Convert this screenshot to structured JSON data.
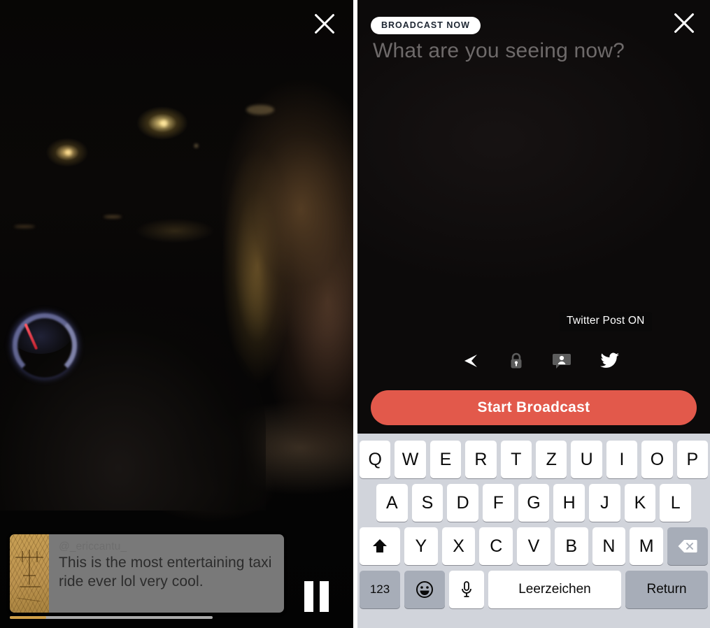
{
  "left_panel": {
    "name": "live-video-player",
    "close_icon": "close-x-icon",
    "scene_description": "night time taxi ride dashcam view",
    "playback": {
      "state_icon": "pause-icon",
      "progress_percent": 18
    },
    "comment": {
      "handle": "@_ericcantu_",
      "text": "This is the most entertaining taxi ride ever lol very cool.",
      "avatar_icon": "sketch-face-avatar"
    }
  },
  "right_panel": {
    "badge": "BROADCAST NOW",
    "close_icon": "close-x-icon",
    "compose": {
      "placeholder": "What are you seeing now?",
      "value": ""
    },
    "tooltip": "Twitter Post ON",
    "options": [
      {
        "name": "location-icon",
        "label": "Location",
        "state": "on",
        "color": "#ffffff"
      },
      {
        "name": "lock-icon",
        "label": "Private",
        "state": "off",
        "color": "#5c5c5c"
      },
      {
        "name": "chat-person-icon",
        "label": "Chat",
        "state": "off",
        "color": "#5c5c5c"
      },
      {
        "name": "twitter-bird-icon",
        "label": "Twitter Post",
        "state": "on",
        "color": "#ffffff"
      }
    ],
    "start_button": {
      "label": "Start Broadcast",
      "color": "#e2594b"
    }
  },
  "keyboard": {
    "layout": "QWERTZ",
    "row1": [
      "Q",
      "W",
      "E",
      "R",
      "T",
      "Z",
      "U",
      "I",
      "O",
      "P"
    ],
    "row2": [
      "A",
      "S",
      "D",
      "F",
      "G",
      "H",
      "J",
      "K",
      "L"
    ],
    "row3_letters": [
      "Y",
      "X",
      "C",
      "V",
      "B",
      "N",
      "M"
    ],
    "shift_icon": "shift-arrow-icon",
    "backspace_icon": "backspace-delete-icon",
    "numbers_key": "123",
    "emoji_icon": "smiley-face-icon",
    "mic_icon": "microphone-icon",
    "space_key": "Leerzeichen",
    "return_key": "Return",
    "background_color": "#d1d4db",
    "key_color": "#ffffff",
    "modifier_key_color": "#a7adb8"
  }
}
